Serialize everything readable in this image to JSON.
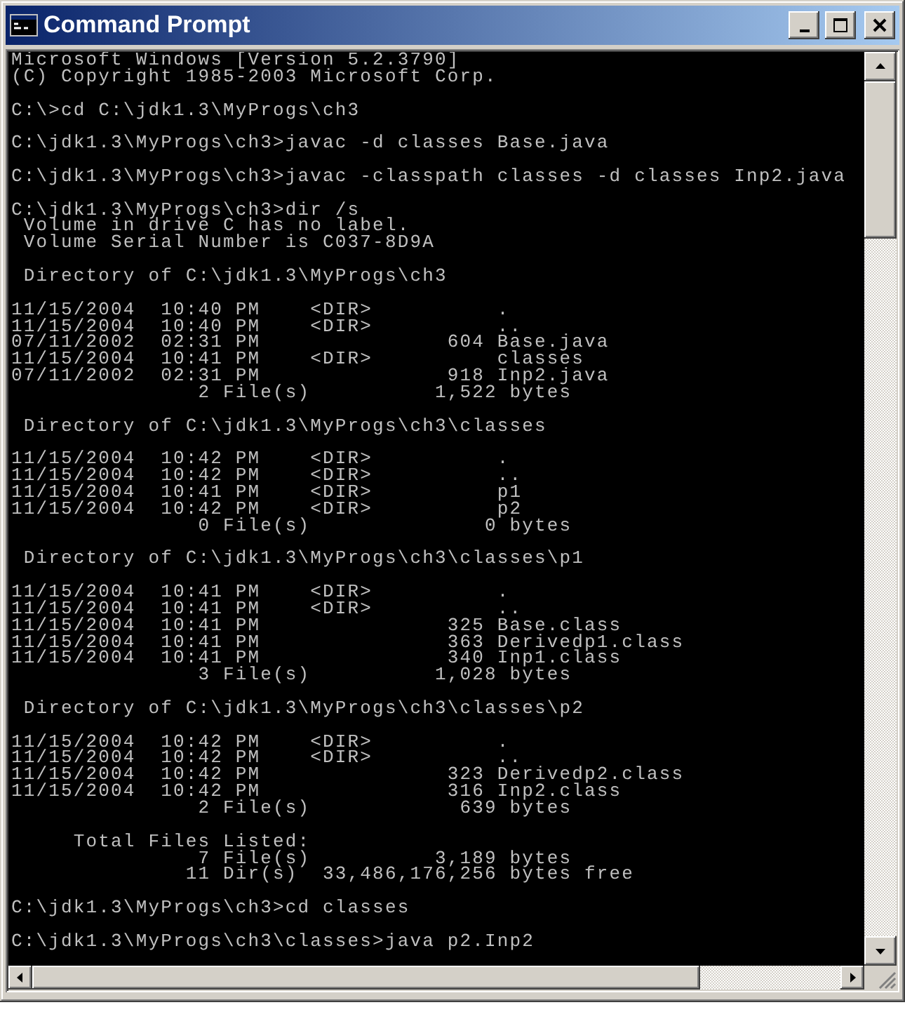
{
  "window": {
    "title": "Command Prompt"
  },
  "console": {
    "blocks": [
      [
        "Microsoft Windows [Version 5.2.3790]",
        "(C) Copyright 1985-2003 Microsoft Corp."
      ],
      [
        "C:\\>cd C:\\jdk1.3\\MyProgs\\ch3"
      ],
      [
        "C:\\jdk1.3\\MyProgs\\ch3>javac -d classes Base.java"
      ],
      [
        "C:\\jdk1.3\\MyProgs\\ch3>javac -classpath classes -d classes Inp2.java"
      ],
      [
        "C:\\jdk1.3\\MyProgs\\ch3>dir /s",
        " Volume in drive C has no label.",
        " Volume Serial Number is C037-8D9A"
      ],
      [
        " Directory of C:\\jdk1.3\\MyProgs\\ch3"
      ],
      [
        "11/15/2004  10:40 PM    <DIR>          .",
        "11/15/2004  10:40 PM    <DIR>          ..",
        "07/11/2002  02:31 PM               604 Base.java",
        "11/15/2004  10:41 PM    <DIR>          classes",
        "07/11/2002  02:31 PM               918 Inp2.java",
        "               2 File(s)          1,522 bytes"
      ],
      [
        " Directory of C:\\jdk1.3\\MyProgs\\ch3\\classes"
      ],
      [
        "11/15/2004  10:42 PM    <DIR>          .",
        "11/15/2004  10:42 PM    <DIR>          ..",
        "11/15/2004  10:41 PM    <DIR>          p1",
        "11/15/2004  10:42 PM    <DIR>          p2",
        "               0 File(s)              0 bytes"
      ],
      [
        " Directory of C:\\jdk1.3\\MyProgs\\ch3\\classes\\p1"
      ],
      [
        "11/15/2004  10:41 PM    <DIR>          .",
        "11/15/2004  10:41 PM    <DIR>          ..",
        "11/15/2004  10:41 PM               325 Base.class",
        "11/15/2004  10:41 PM               363 Derivedp1.class",
        "11/15/2004  10:41 PM               340 Inp1.class",
        "               3 File(s)          1,028 bytes"
      ],
      [
        " Directory of C:\\jdk1.3\\MyProgs\\ch3\\classes\\p2"
      ],
      [
        "11/15/2004  10:42 PM    <DIR>          .",
        "11/15/2004  10:42 PM    <DIR>          ..",
        "11/15/2004  10:42 PM               323 Derivedp2.class",
        "11/15/2004  10:42 PM               316 Inp2.class",
        "               2 File(s)            639 bytes"
      ],
      [
        "     Total Files Listed:",
        "               7 File(s)          3,189 bytes",
        "              11 Dir(s)  33,486,176,256 bytes free"
      ],
      [
        "C:\\jdk1.3\\MyProgs\\ch3>cd classes"
      ],
      [
        "C:\\jdk1.3\\MyProgs\\ch3\\classes>java p2.Inp2"
      ]
    ]
  }
}
